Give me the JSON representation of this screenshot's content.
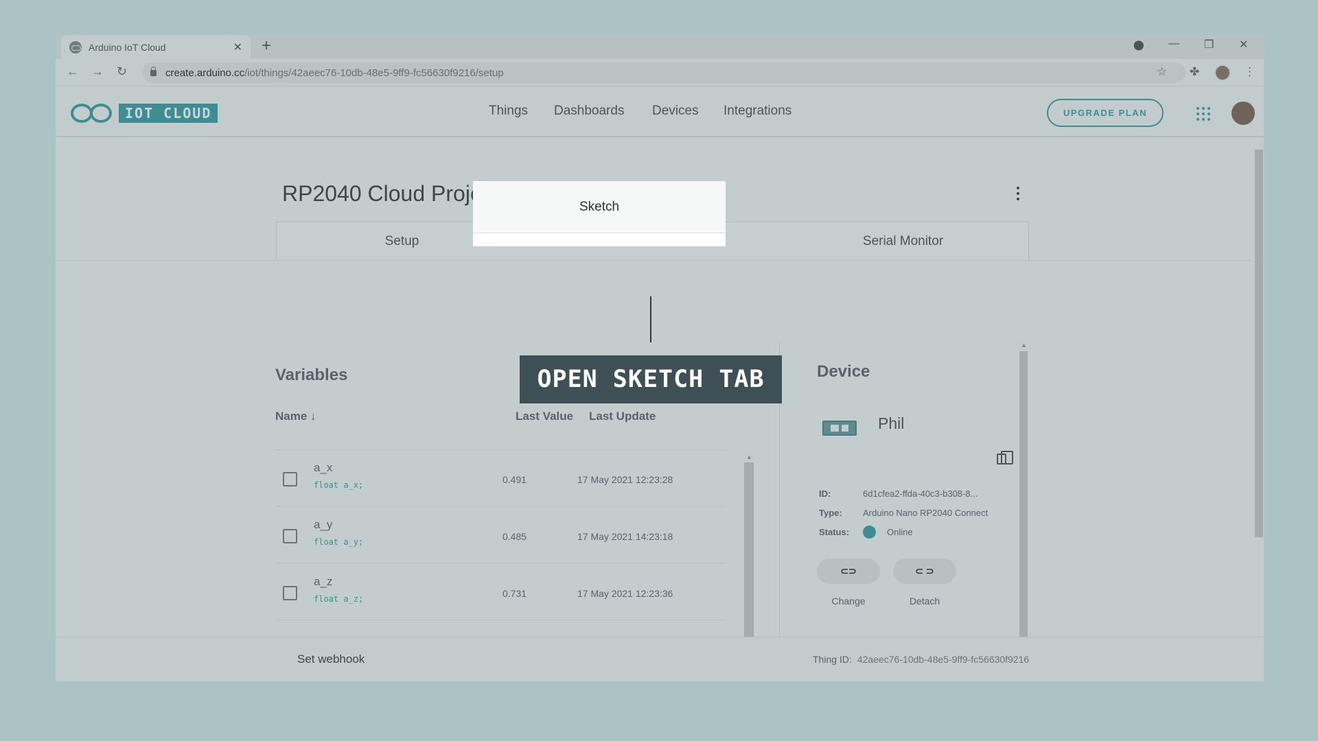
{
  "browser": {
    "tab_title": "Arduino IoT Cloud",
    "url_host": "create.arduino.cc",
    "url_path": "/iot/things/42aeec76-10db-48e5-9ff9-fc56630f9216/setup"
  },
  "header": {
    "logo_text": "IOT CLOUD",
    "nav": [
      "Things",
      "Dashboards",
      "Devices",
      "Integrations"
    ],
    "upgrade_label": "UPGRADE PLAN"
  },
  "thing": {
    "title": "RP2040 Cloud Project.",
    "tabs": [
      "Setup",
      "Sketch",
      "Serial Monitor"
    ],
    "active_tab": "Sketch"
  },
  "callout": {
    "text": "OPEN SKETCH TAB"
  },
  "variables": {
    "title": "Variables",
    "columns": {
      "name": "Name",
      "last_value": "Last Value",
      "last_update": "Last Update"
    },
    "sort_icon": "arrow-down-icon",
    "rows": [
      {
        "name": "a_x",
        "decl": "float a_x;",
        "value": "0.491",
        "updated": "17 May 2021 12:23:28"
      },
      {
        "name": "a_y",
        "decl": "float a_y;",
        "value": "0.485",
        "updated": "17 May 2021 14:23:18"
      },
      {
        "name": "a_z",
        "decl": "float a_z;",
        "value": "0.731",
        "updated": "17 May 2021 12:23:36"
      }
    ]
  },
  "device": {
    "title": "Device",
    "name": "Phil",
    "id_label": "ID:",
    "id_value": "6d1cfea2-ffda-40c3-b308-8...",
    "type_label": "Type:",
    "type_value": "Arduino Nano RP2040 Connect",
    "status_label": "Status:",
    "status_value": "Online",
    "change_label": "Change",
    "detach_label": "Detach"
  },
  "footer": {
    "webhook_label": "Set webhook",
    "thing_id_label": "Thing ID:",
    "thing_id_value": "42aeec76-10db-48e5-9ff9-fc56630f9216"
  },
  "colors": {
    "accent": "#3f8d93",
    "overlay": "#c3cccd",
    "callout_bg": "#3e5056"
  }
}
